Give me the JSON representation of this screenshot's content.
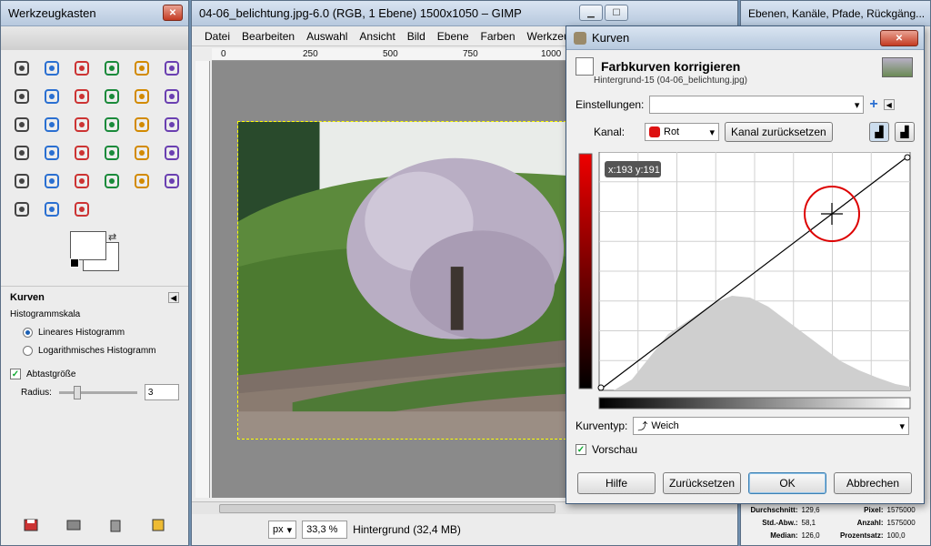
{
  "toolbox": {
    "title": "Werkzeugkasten",
    "options_title": "Kurven",
    "histogram_scale_label": "Histogrammskala",
    "linear_label": "Lineares Histogramm",
    "log_label": "Logarithmisches Histogramm",
    "sample_label": "Abtastgröße",
    "radius_label": "Radius:",
    "radius_value": "3",
    "linear_selected": true,
    "sample_checked": true
  },
  "image_window": {
    "title": "04-06_belichtung.jpg-6.0 (RGB, 1 Ebene) 1500x1050 – GIMP",
    "menu": [
      "Datei",
      "Bearbeiten",
      "Auswahl",
      "Ansicht",
      "Bild",
      "Ebene",
      "Farben",
      "Werkzeuge"
    ],
    "ruler_ticks": [
      "0",
      "250",
      "500",
      "750",
      "1000"
    ],
    "unit": "px",
    "zoom": "33,3 %",
    "status": "Hintergrund (32,4 MB)"
  },
  "dock": {
    "title": "Ebenen, Kanäle, Pfade, Rückgäng...",
    "stats": [
      {
        "k": "Durchschnitt:",
        "v": "129,6",
        "k2": "Pixel:",
        "v2": "1575000"
      },
      {
        "k": "Std.-Abw.:",
        "v": "58,1",
        "k2": "Anzahl:",
        "v2": "1575000"
      },
      {
        "k": "Median:",
        "v": "126,0",
        "k2": "Prozentsatz:",
        "v2": "100,0"
      }
    ]
  },
  "curves_dialog": {
    "title": "Kurven",
    "heading": "Farbkurven korrigieren",
    "subtitle": "Hintergrund-15 (04-06_belichtung.jpg)",
    "settings_label": "Einstellungen:",
    "settings_value": "",
    "channel_label": "Kanal:",
    "channel_value": "Rot",
    "reset_channel_label": "Kanal zurücksetzen",
    "coords": "x:193 y:191",
    "curve_type_label": "Kurventyp:",
    "curve_type_value": "Weich",
    "preview_label": "Vorschau",
    "preview_checked": true,
    "buttons": {
      "help": "Hilfe",
      "reset": "Zurücksetzen",
      "ok": "OK",
      "cancel": "Abbrechen"
    },
    "colors": {
      "channel": "#cc0000",
      "marker": "#dd0000"
    }
  },
  "icons": {
    "tools": [
      "rect-select-icon",
      "ellipse-select-icon",
      "free-select-icon",
      "fuzzy-select-icon",
      "color-select-icon",
      "scissors-icon",
      "foreground-select-icon",
      "paths-icon",
      "color-picker-icon",
      "zoom-icon",
      "measure-icon",
      "move-icon",
      "align-icon",
      "crop-icon",
      "rotate-icon",
      "scale-icon",
      "shear-icon",
      "perspective-icon",
      "flip-icon",
      "text-icon",
      "bucket-fill-icon",
      "blend-icon",
      "pencil-icon",
      "paintbrush-icon",
      "eraser-icon",
      "airbrush-icon",
      "ink-icon",
      "clone-icon",
      "heal-icon",
      "perspective-clone-icon",
      "blur-icon",
      "smudge-icon",
      "dodge-burn-icon"
    ]
  }
}
